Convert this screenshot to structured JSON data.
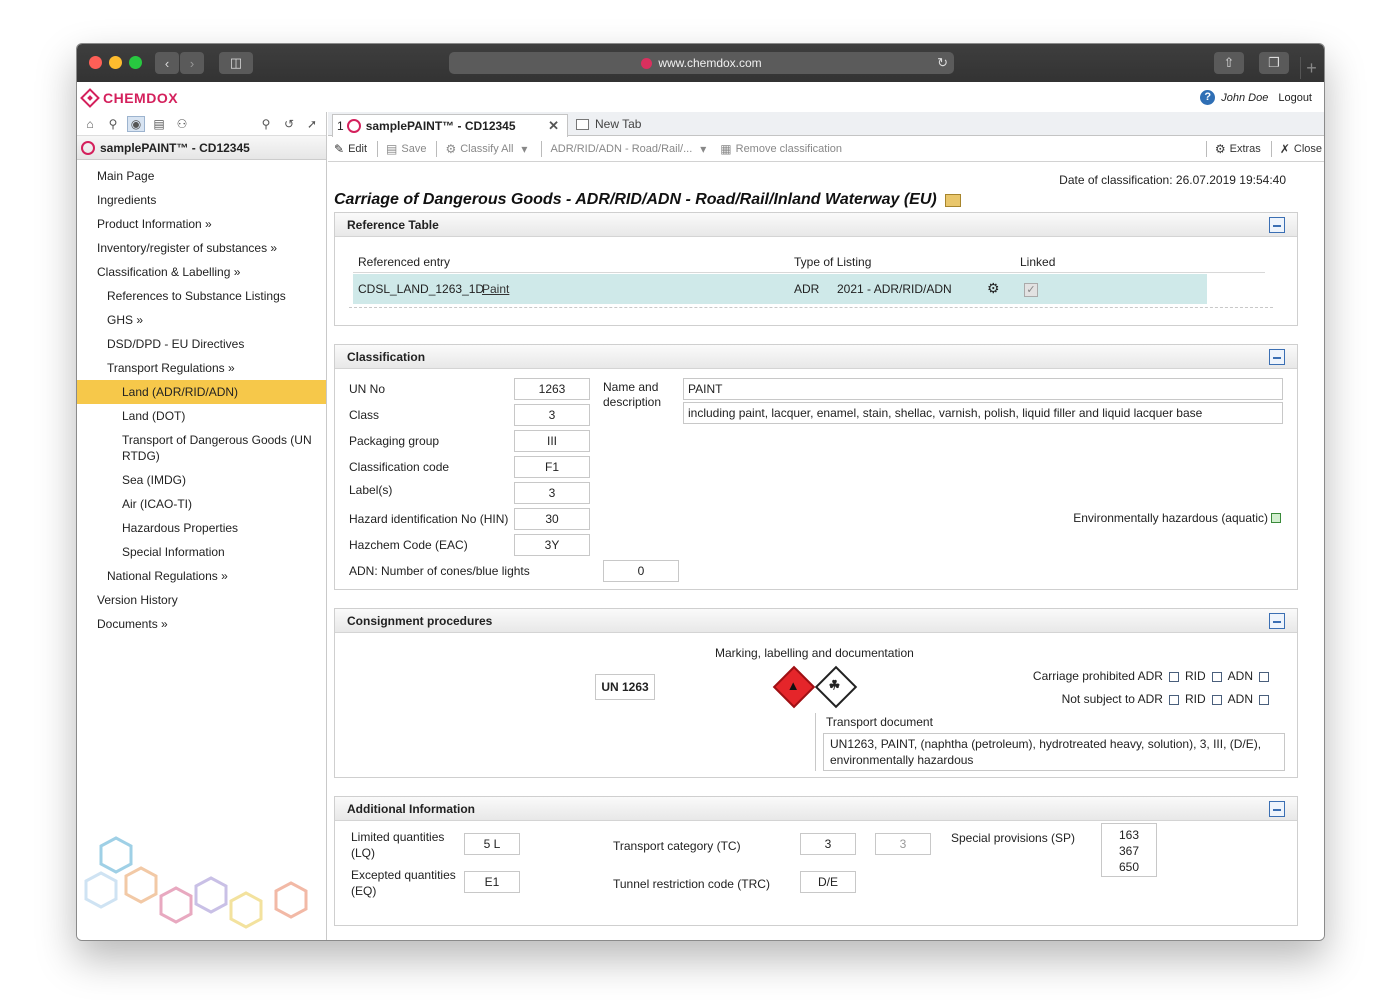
{
  "browser": {
    "url": "www.chemdox.com"
  },
  "app": {
    "logo_text": "CHEMDOX",
    "user": "John Doe",
    "logout_label": "Logout"
  },
  "sidebar": {
    "product": "samplePAINT™ - CD12345",
    "items": [
      {
        "label": "Main Page",
        "level": 1
      },
      {
        "label": "Ingredients",
        "level": 1
      },
      {
        "label": "Product Information »",
        "level": 1
      },
      {
        "label": "Inventory/register of substances »",
        "level": 1
      },
      {
        "label": "Classification & Labelling »",
        "level": 1
      },
      {
        "label": "References to Substance Listings",
        "level": 2
      },
      {
        "label": "GHS »",
        "level": 2
      },
      {
        "label": "DSD/DPD - EU Directives",
        "level": 2
      },
      {
        "label": "Transport Regulations »",
        "level": 2
      },
      {
        "label": "Land (ADR/RID/ADN)",
        "level": 3,
        "selected": true
      },
      {
        "label": "Land (DOT)",
        "level": 3
      },
      {
        "label": "Transport of Dangerous Goods (UN RTDG)",
        "level": 3
      },
      {
        "label": "Sea (IMDG)",
        "level": 3
      },
      {
        "label": "Air (ICAO-TI)",
        "level": 3
      },
      {
        "label": "Hazardous Properties",
        "level": 3
      },
      {
        "label": "Special Information",
        "level": 3
      },
      {
        "label": "National Regulations »",
        "level": 2
      },
      {
        "label": "Version History",
        "level": 1
      },
      {
        "label": "Documents »",
        "level": 1
      }
    ]
  },
  "tabs": {
    "active_num": "1",
    "active_label": "samplePAINT™ - CD12345",
    "new_tab_label": "New Tab"
  },
  "toolbar": {
    "edit": "Edit",
    "save": "Save",
    "classify_all": "Classify All",
    "regulation_select": "ADR/RID/ADN - Road/Rail/...",
    "remove_classification": "Remove classification",
    "extras": "Extras",
    "close": "Close"
  },
  "page": {
    "date_label": "Date of classification:",
    "date_value": "26.07.2019 19:54:40",
    "title": "Carriage of Dangerous Goods - ADR/RID/ADN - Road/Rail/Inland Waterway (EU)"
  },
  "reference_table": {
    "heading": "Reference Table",
    "col_entry": "Referenced entry",
    "col_type": "Type of Listing",
    "col_linked": "Linked",
    "row": {
      "entry": "CDSL_LAND_1263_1D",
      "entry_link": "Paint",
      "type": "ADR",
      "listing": "2021 - ADR/RID/ADN"
    }
  },
  "classification": {
    "heading": "Classification",
    "fields": [
      {
        "label": "UN No",
        "value": "1263"
      },
      {
        "label": "Class",
        "value": "3"
      },
      {
        "label": "Packaging group",
        "value": "III"
      },
      {
        "label": "Classification code",
        "value": "F1"
      },
      {
        "label": "Label(s)",
        "value": "3"
      },
      {
        "label": "Hazard identification No (HIN)",
        "value": "30"
      },
      {
        "label": "Hazchem Code (EAC)",
        "value": "3Y"
      }
    ],
    "adn_label": "ADN: Number of cones/blue lights",
    "adn_value": "0",
    "name_label_1": "Name and",
    "name_label_2": "description",
    "name_value": "PAINT",
    "description_value": "including paint, lacquer, enamel, stain, shellac, varnish, polish, liquid filler and liquid lacquer base",
    "env_label": "Environmentally hazardous (aquatic)"
  },
  "consignment": {
    "heading": "Consignment procedures",
    "marking_label": "Marking, labelling and documentation",
    "un_label": "UN 1263",
    "carriage_prohibited": "Carriage prohibited",
    "not_subject_to": "Not subject to",
    "mode_adr": "ADR",
    "mode_rid": "RID",
    "mode_adn": "ADN",
    "transport_doc_label": "Transport document",
    "transport_doc_value": "UN1263, PAINT, (naphtha (petroleum), hydrotreated heavy, solution), 3, III, (D/E), environmentally hazardous"
  },
  "additional": {
    "heading": "Additional Information",
    "lq_label_1": "Limited quantities",
    "lq_label_2": "(LQ)",
    "lq_value": "5 L",
    "eq_label_1": "Excepted quantities",
    "eq_label_2": "(EQ)",
    "eq_value": "E1",
    "tc_label": "Transport category (TC)",
    "tc_value": "3",
    "tc_value_2": "3",
    "trc_label": "Tunnel restriction code (TRC)",
    "trc_value": "D/E",
    "sp_label": "Special provisions (SP)",
    "sp_values": [
      "163",
      "367",
      "650"
    ]
  }
}
